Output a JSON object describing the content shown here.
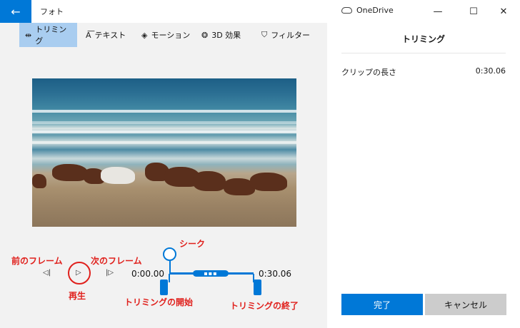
{
  "titlebar": {
    "back_glyph": "←",
    "app_title": "フォト",
    "onedrive_label": "OneDrive",
    "minimize_glyph": "—",
    "maximize_glyph": "☐",
    "close_glyph": "✕"
  },
  "toolbar": {
    "trim": {
      "icon": "trim-icon",
      "glyph": "⇹",
      "label": "トリミング"
    },
    "text": {
      "icon": "text-icon",
      "glyph": "A͞",
      "label": "テキスト"
    },
    "motion": {
      "icon": "motion-icon",
      "glyph": "◈",
      "label": "モーション"
    },
    "effects3d": {
      "icon": "3d-effects-icon",
      "glyph": "❂",
      "label": "3D 効果"
    },
    "filter": {
      "icon": "filter-icon",
      "glyph": "⛉",
      "label": "フィルター"
    }
  },
  "panel": {
    "title": "トリミング",
    "clip_length_label": "クリップの長さ",
    "clip_length_value": "0:30.06",
    "done_label": "完了",
    "cancel_label": "キャンセル"
  },
  "playback": {
    "prev_frame_glyph": "◁|",
    "play_glyph": "▷",
    "next_frame_glyph": "|▷",
    "start_time": "0:00.00",
    "end_time": "0:30.06",
    "grip_glyph": "▪▪▪",
    "seek_position": 0.0
  },
  "annotations": {
    "prev_frame": "前のフレーム",
    "next_frame": "次のフレーム",
    "play": "再生",
    "seek": "シーク",
    "trim_start": "トリミングの開始",
    "trim_end": "トリミングの終了"
  },
  "colors": {
    "accent": "#0078d7",
    "annotation": "#e0201c",
    "active_tool": "#a9cdf0"
  }
}
